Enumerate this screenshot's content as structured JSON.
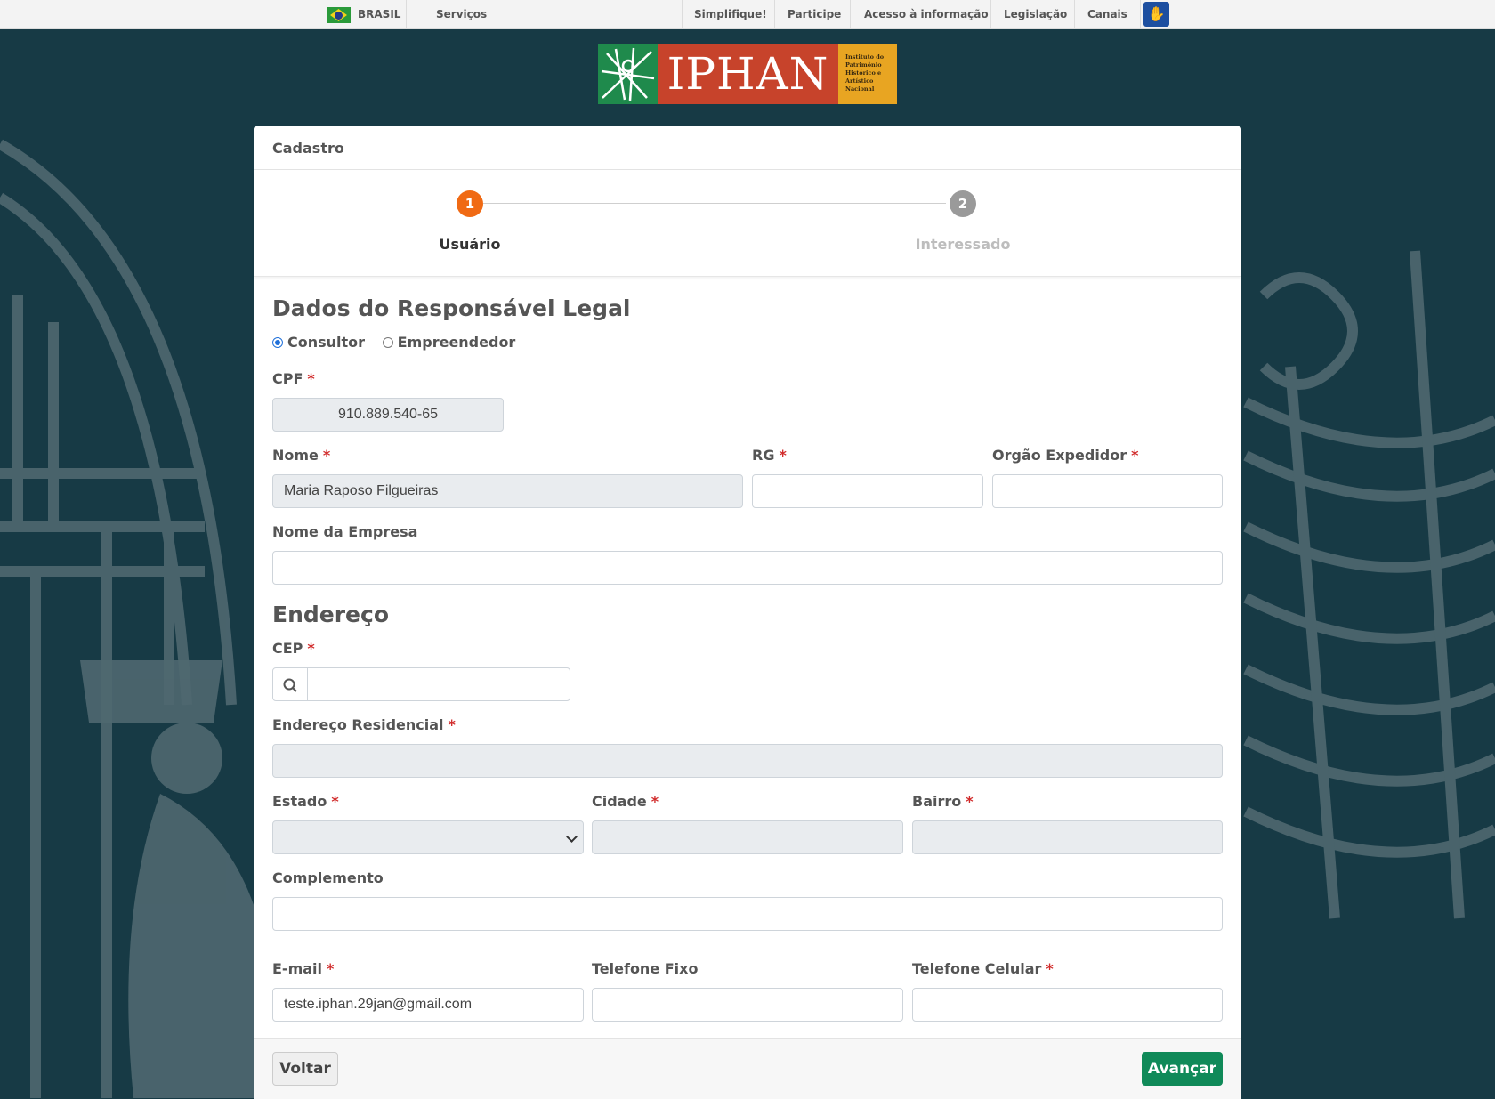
{
  "govbar": {
    "country": "BRASIL",
    "servicos": "Serviços",
    "links": [
      "Simplifique!",
      "Participe",
      "Acesso à informação",
      "Legislação",
      "Canais"
    ]
  },
  "logo": {
    "name": "IPHAN",
    "subtitle_lines": [
      "Instituto do",
      "Patrimônio",
      "Histórico e",
      "Artístico",
      "Nacional"
    ]
  },
  "card": {
    "title": "Cadastro"
  },
  "stepper": {
    "steps": [
      {
        "number": "1",
        "label": "Usuário",
        "state": "active"
      },
      {
        "number": "2",
        "label": "Interessado",
        "state": "inactive"
      }
    ]
  },
  "form": {
    "section_responsavel": "Dados do Responsável Legal",
    "tipo": {
      "options": [
        "Consultor",
        "Empreendedor"
      ],
      "selected": "Consultor"
    },
    "cpf_label": "CPF",
    "cpf_value": "910.889.540-65",
    "nome_label": "Nome",
    "nome_value": "Maria Raposo Filgueiras",
    "rg_label": "RG",
    "rg_value": "",
    "orgao_label": "Orgão Expedidor",
    "orgao_value": "",
    "empresa_label": "Nome da Empresa",
    "empresa_value": "",
    "section_endereco": "Endereço",
    "cep_label": "CEP",
    "cep_value": "",
    "endereco_label": "Endereço Residencial",
    "endereco_value": "",
    "estado_label": "Estado",
    "estado_value": "",
    "cidade_label": "Cidade",
    "cidade_value": "",
    "bairro_label": "Bairro",
    "bairro_value": "",
    "complemento_label": "Complemento",
    "complemento_value": "",
    "email_label": "E-mail",
    "email_value": "teste.iphan.29jan@gmail.com",
    "tel_fixo_label": "Telefone Fixo",
    "tel_fixo_value": "",
    "tel_cel_label": "Telefone Celular",
    "tel_cel_value": "",
    "required_mark": "*"
  },
  "footer": {
    "back_label": "Voltar",
    "next_label": "Avançar"
  },
  "colors": {
    "background": "#173a45",
    "step_active": "#f06a14",
    "step_inactive": "#9a9a9a",
    "primary_button": "#108a59",
    "required": "#d12b2b"
  },
  "icons": [
    "brazil-flag-icon",
    "accessibility-icon",
    "search-icon",
    "chevron-down-icon"
  ]
}
